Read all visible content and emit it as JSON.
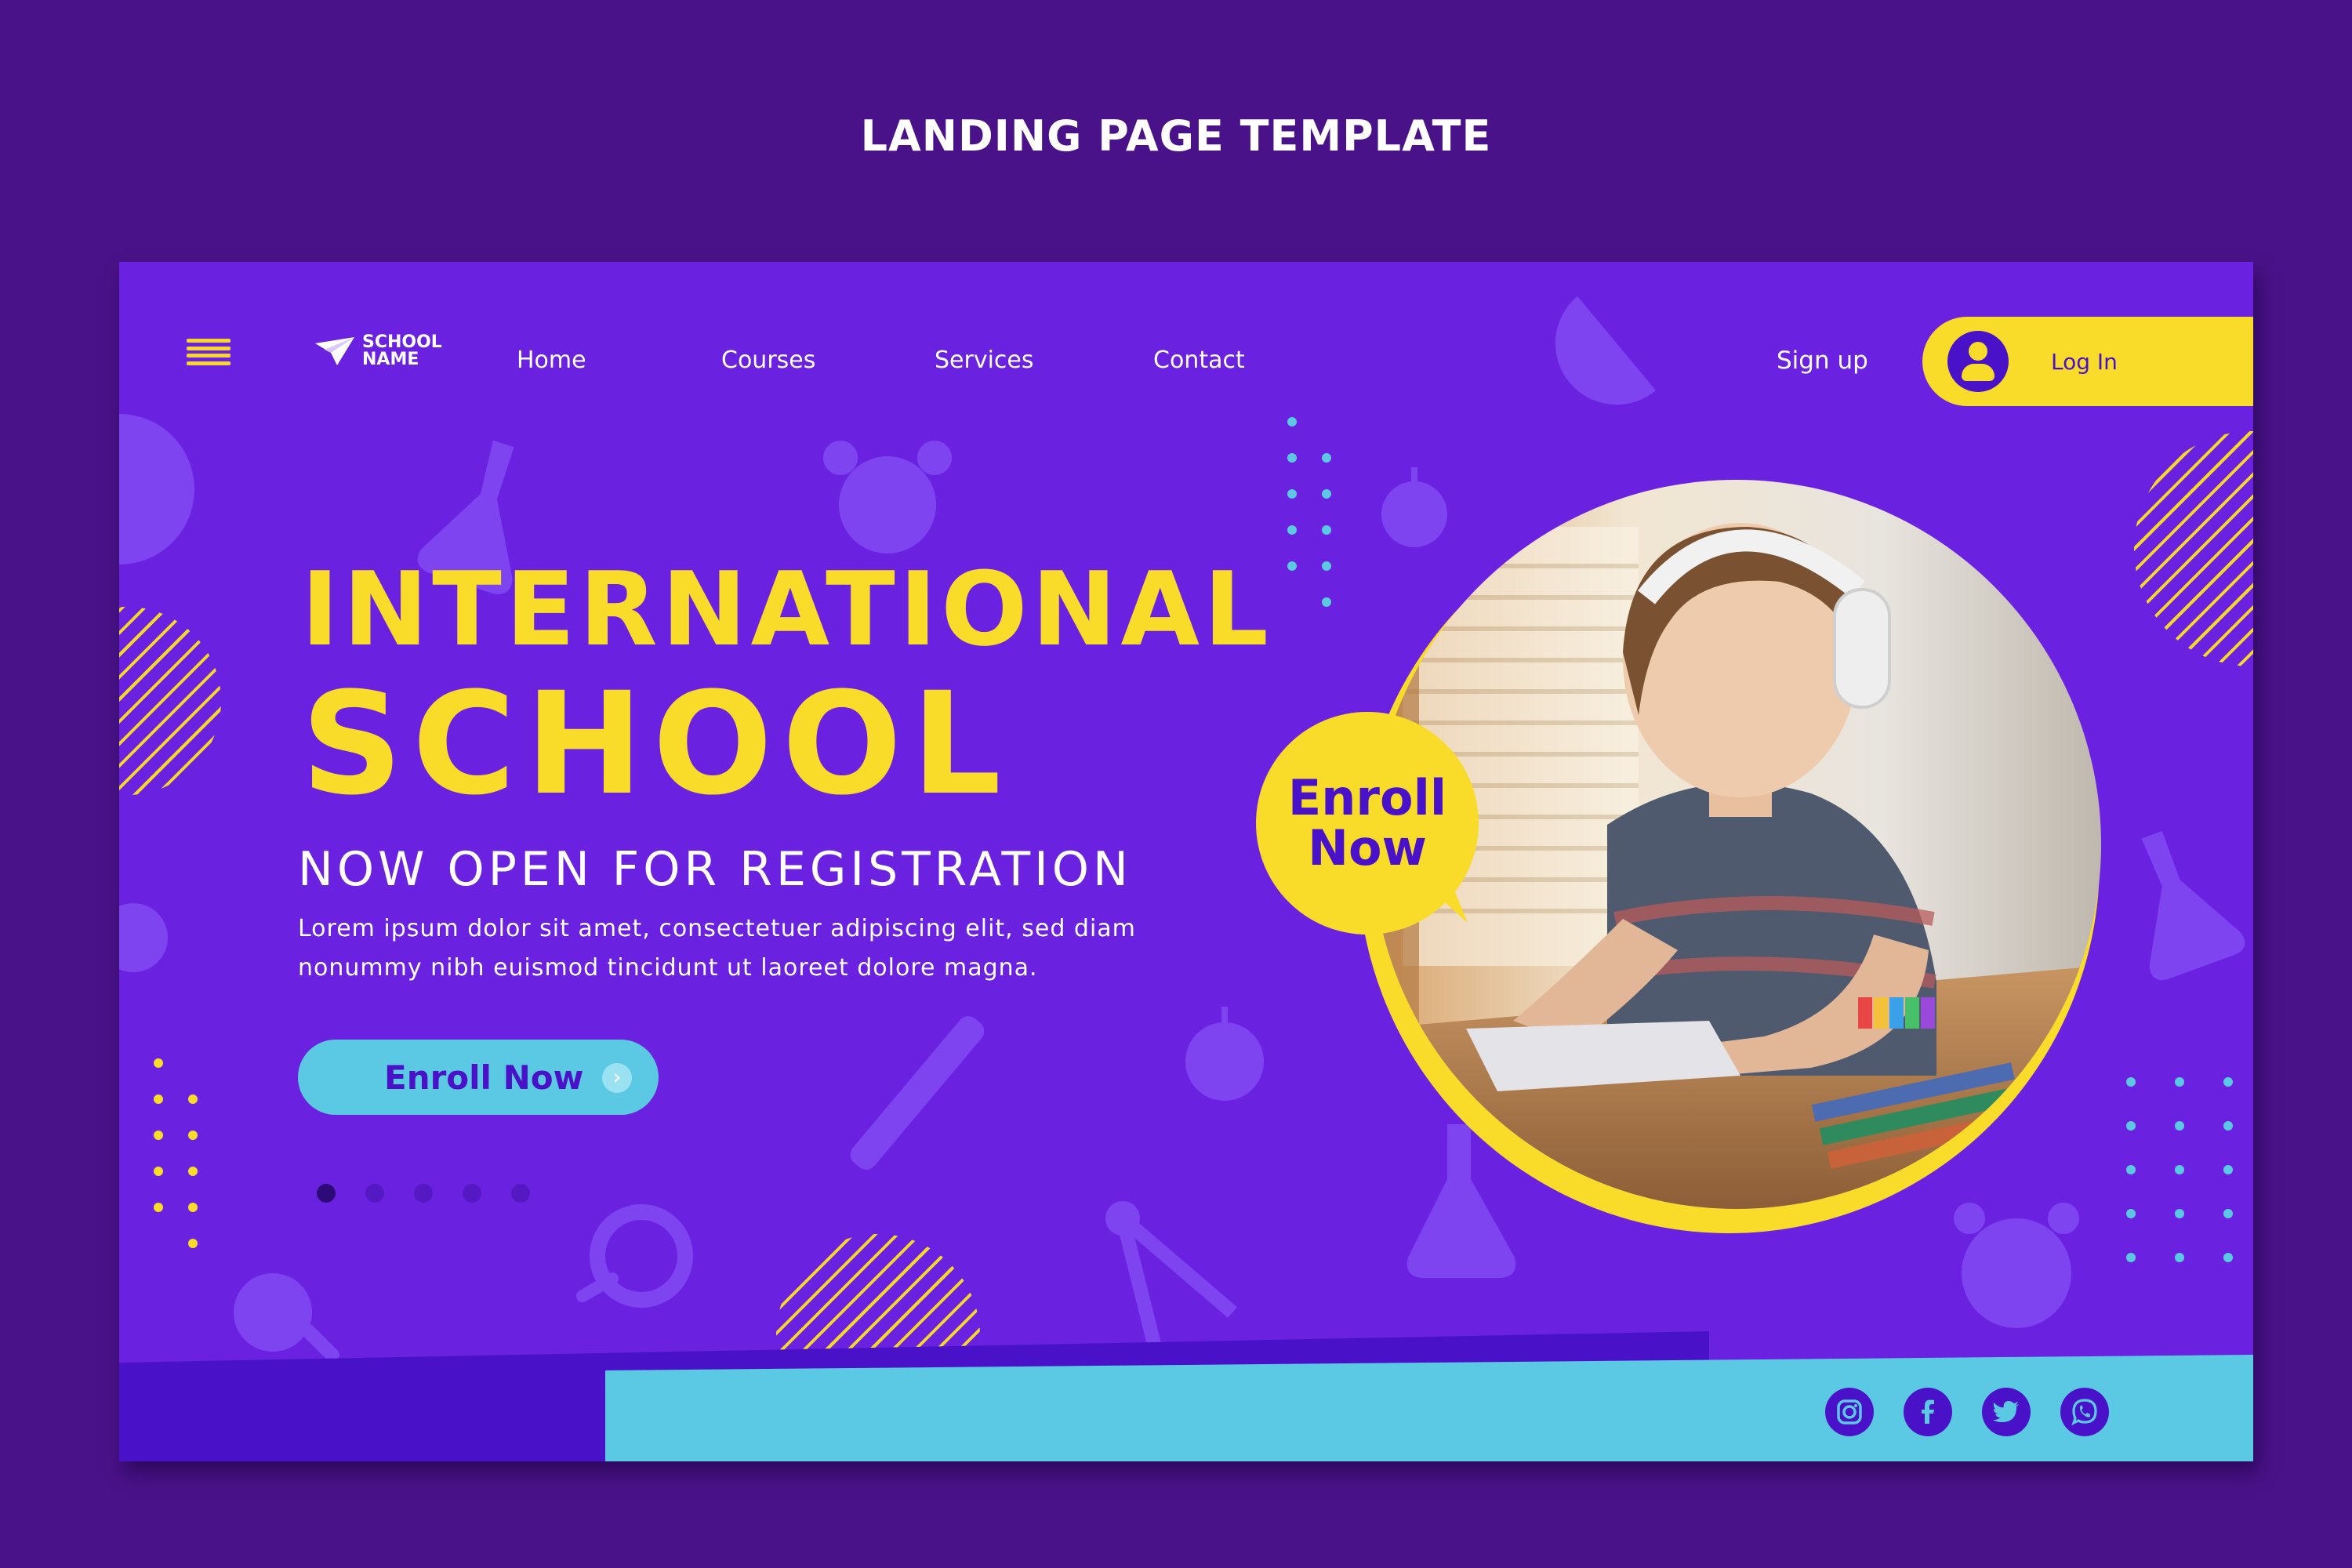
{
  "page_heading": "LANDING PAGE TEMPLATE",
  "colors": {
    "background": "#4a1288",
    "frame": "#6a22e0",
    "accent_yellow": "#f9dc2a",
    "accent_cyan": "#5cc9e4",
    "deep_purple": "#4a12c8"
  },
  "nav": {
    "menu_icon": "hamburger-menu-icon",
    "logo_icon": "paper-plane-icon",
    "logo_line1": "SCHOOL",
    "logo_line2": "NAME",
    "links": [
      "Home",
      "Courses",
      "Services",
      "Contact"
    ],
    "signup": "Sign up",
    "login": "Log In",
    "login_icon": "user-icon"
  },
  "hero": {
    "title_line1": "INTERNATIONAL",
    "title_line2": "SCHOOL",
    "subtitle": "NOW OPEN FOR REGISTRATION",
    "body_line1": "Lorem ipsum dolor sit amet, consectetuer adipiscing elit, sed diam",
    "body_line2": "nonummy nibh euismod tincidunt ut laoreet dolore magna.",
    "cta_label": "Enroll Now",
    "cta_icon": "chevron-right-icon",
    "slide_count": 5,
    "active_slide": 1
  },
  "bubble": {
    "line1": "Enroll",
    "line2": "Now"
  },
  "photo": {
    "subject": "child-with-headphones-using-laptop"
  },
  "social": [
    "instagram-icon",
    "facebook-icon",
    "twitter-icon",
    "whatsapp-icon"
  ]
}
